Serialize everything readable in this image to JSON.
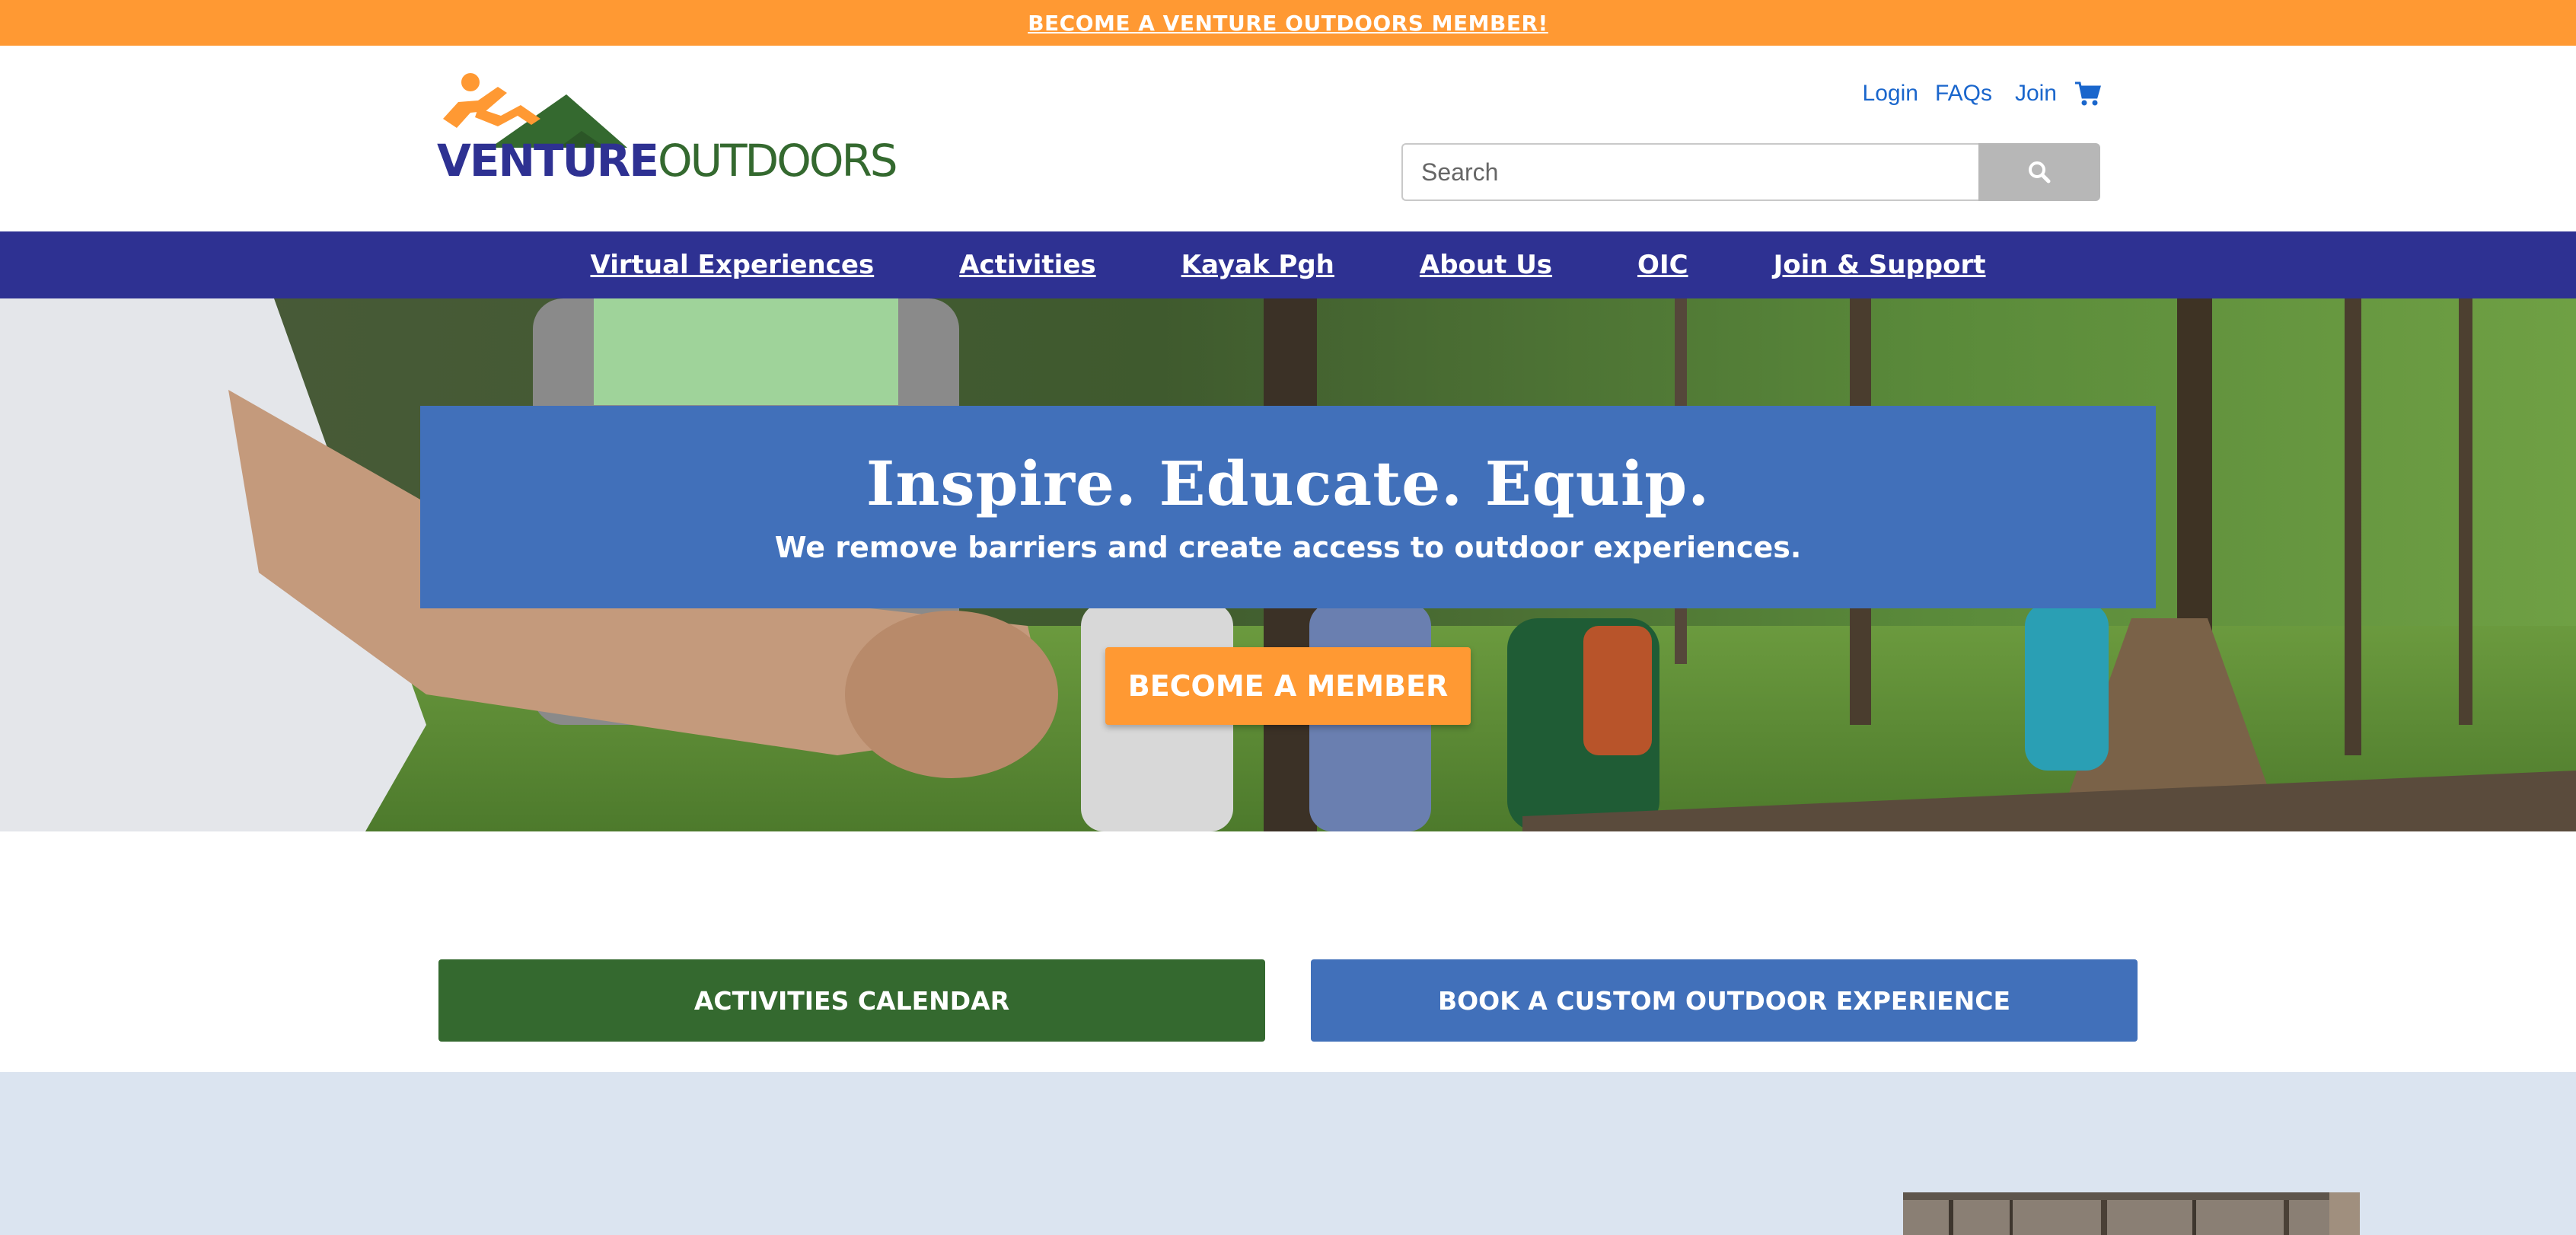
{
  "promo": {
    "link_text": "BECOME A VENTURE OUTDOORS MEMBER!"
  },
  "brand": {
    "logo_word1": "VENTURE",
    "logo_word2": "OUTDOORS",
    "colors": {
      "orange": "#ff9933",
      "navy": "#2e3192",
      "green": "#34692f",
      "blue": "#4170ba"
    }
  },
  "util_nav": {
    "login": "Login",
    "faqs": "FAQs",
    "join": "Join",
    "cart_icon": "shopping-cart-icon"
  },
  "search": {
    "placeholder": "Search",
    "button_icon": "search-icon"
  },
  "main_nav": {
    "items": [
      {
        "label": "Virtual Experiences"
      },
      {
        "label": "Activities"
      },
      {
        "label": "Kayak Pgh"
      },
      {
        "label": "About Us"
      },
      {
        "label": "OIC"
      },
      {
        "label": "Join & Support"
      }
    ]
  },
  "hero": {
    "title": "Inspire. Educate. Equip.",
    "subtitle": "We remove barriers and create access to outdoor experiences.",
    "cta_label": "BECOME A MEMBER"
  },
  "cta": {
    "calendar_label": "ACTIVITIES CALENDAR",
    "custom_label": "BOOK A CUSTOM OUTDOOR EXPERIENCE"
  }
}
